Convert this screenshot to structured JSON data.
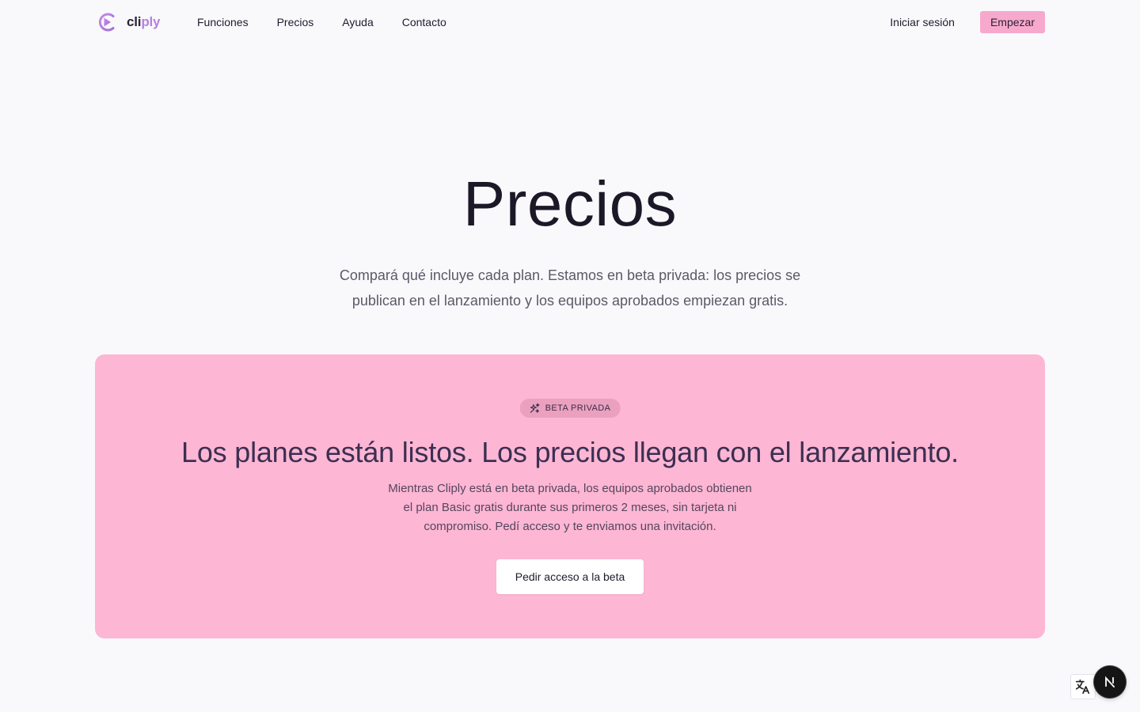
{
  "header": {
    "logo": {
      "text_part1": "cli",
      "text_part2": "ply",
      "icon": "play-circle-logo-icon"
    },
    "nav": [
      {
        "label": "Funciones"
      },
      {
        "label": "Precios"
      },
      {
        "label": "Ayuda"
      },
      {
        "label": "Contacto"
      }
    ],
    "login_label": "Iniciar sesión",
    "cta_label": "Empezar"
  },
  "hero": {
    "title": "Precios",
    "subtitle": "Compará qué incluye cada plan. Estamos en beta privada: los precios se publican en el lanzamiento y los equipos aprobados empiezan gratis."
  },
  "beta_card": {
    "badge_icon": "sparkles-icon",
    "badge_label": "BETA PRIVADA",
    "title": "Los planes están listos. Los precios llegan con el lanzamiento.",
    "description": "Mientras Cliply está en beta privada, los equipos aprobados obtienen el plan Basic gratis durante sus primeros 2 meses, sin tarjeta ni compromiso. Pedí acceso y te enviamos una invitación.",
    "button_label": "Pedir acceso a la beta"
  },
  "widgets": {
    "translate_icon": "translate-icon",
    "next_badge_icon": "nextjs-n-icon"
  },
  "colors": {
    "background": "#f9f9fc",
    "brand_pink": "#f7a9cd",
    "card_pink": "#fdb6d3",
    "logo_purple": "#b77fe0",
    "heading_dark": "#1c1828",
    "card_heading": "#3b2f52"
  }
}
